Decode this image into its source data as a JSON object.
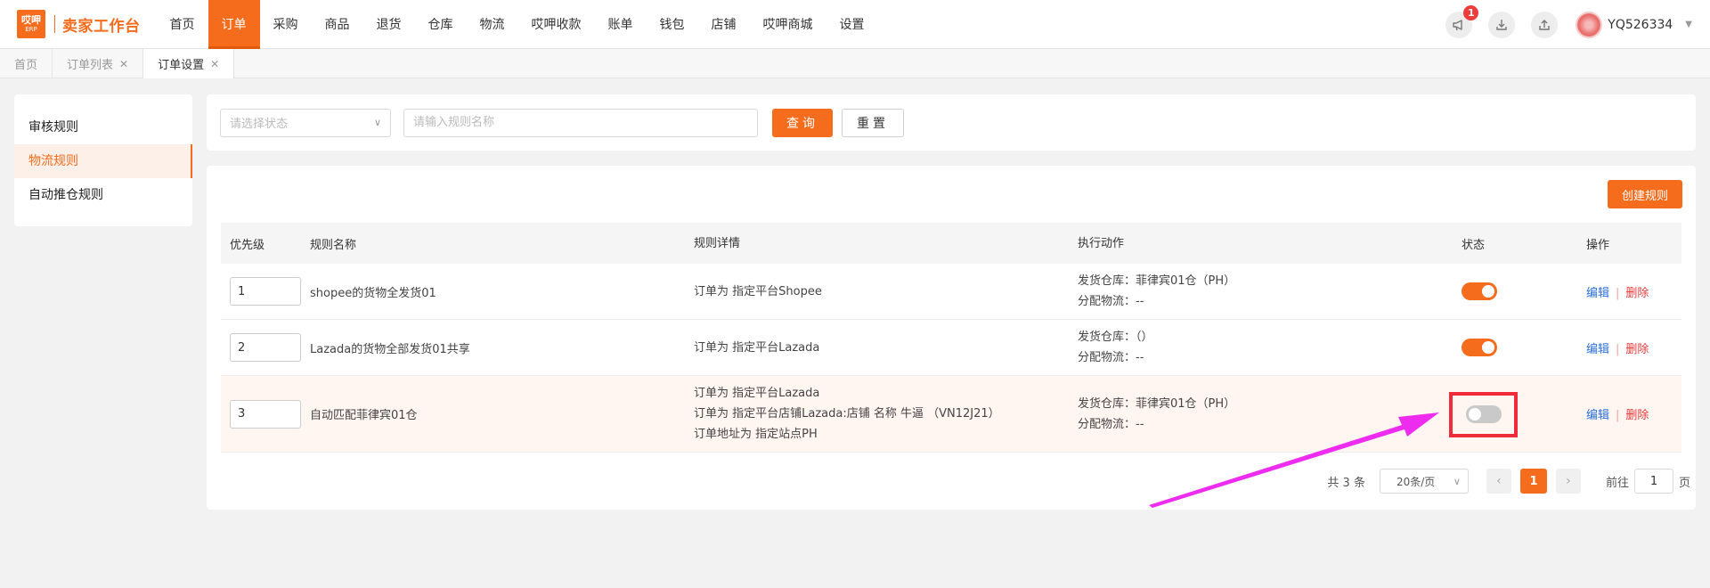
{
  "colors": {
    "accent": "#f56c1d",
    "highlight_box": "#f02c3a",
    "arrow": "#ee2cf0",
    "link": "#2b6fd8",
    "danger": "#e63b3b"
  },
  "header": {
    "logo_line1": "哎呷",
    "logo_line2": "ERP",
    "brand": "卖家工作台",
    "nav": [
      {
        "label": "首页"
      },
      {
        "label": "订单",
        "active": true
      },
      {
        "label": "采购"
      },
      {
        "label": "商品"
      },
      {
        "label": "退货"
      },
      {
        "label": "仓库"
      },
      {
        "label": "物流"
      },
      {
        "label": "哎呷收款"
      },
      {
        "label": "账单"
      },
      {
        "label": "钱包"
      },
      {
        "label": "店铺"
      },
      {
        "label": "哎呷商城"
      },
      {
        "label": "设置"
      }
    ],
    "notification_count": "1",
    "icons": [
      "megaphone-icon",
      "download-icon",
      "upload-icon"
    ],
    "username": "YQ526334"
  },
  "tabs": [
    {
      "label": "首页",
      "closable": false
    },
    {
      "label": "订单列表",
      "closable": true
    },
    {
      "label": "订单设置",
      "closable": true,
      "active": true
    }
  ],
  "sidebar": {
    "items": [
      {
        "label": "审核规则"
      },
      {
        "label": "物流规则",
        "active": true
      },
      {
        "label": "自动推仓规则"
      }
    ]
  },
  "search": {
    "status_placeholder": "请选择状态",
    "name_placeholder": "请输入规则名称",
    "query_label": "查询",
    "reset_label": "重置"
  },
  "create_label": "创建规则",
  "table": {
    "headers": {
      "priority": "优先级",
      "name": "规则名称",
      "detail": "规则详情",
      "action": "执行动作",
      "status": "状态",
      "ops": "操作"
    },
    "rows": [
      {
        "priority": "1",
        "name": "shopee的货物全发货01",
        "details": [
          "订单为 指定平台Shopee"
        ],
        "actions": [
          "发货仓库：菲律宾01仓（PH）",
          "分配物流：--"
        ],
        "enabled": true
      },
      {
        "priority": "2",
        "name": "Lazada的货物全部发货01共享",
        "details": [
          "订单为 指定平台Lazada"
        ],
        "actions": [
          "发货仓库：（）",
          "分配物流：--"
        ],
        "enabled": true
      },
      {
        "priority": "3",
        "name": "自动匹配菲律宾01仓",
        "details": [
          "订单为 指定平台Lazada",
          "订单为 指定平台店铺Lazada:店铺 名称 牛逼 （VN12J21）",
          "订单地址为 指定站点PH"
        ],
        "actions": [
          "发货仓库：菲律宾01仓（PH）",
          "分配物流：--"
        ],
        "enabled": false
      }
    ],
    "edit_label": "编辑",
    "delete_label": "删除"
  },
  "pagination": {
    "total_text": "共 3 条",
    "page_size": "20条/页",
    "current_page": "1",
    "goto_label": "前往",
    "goto_value": "1",
    "page_suffix": "页"
  }
}
